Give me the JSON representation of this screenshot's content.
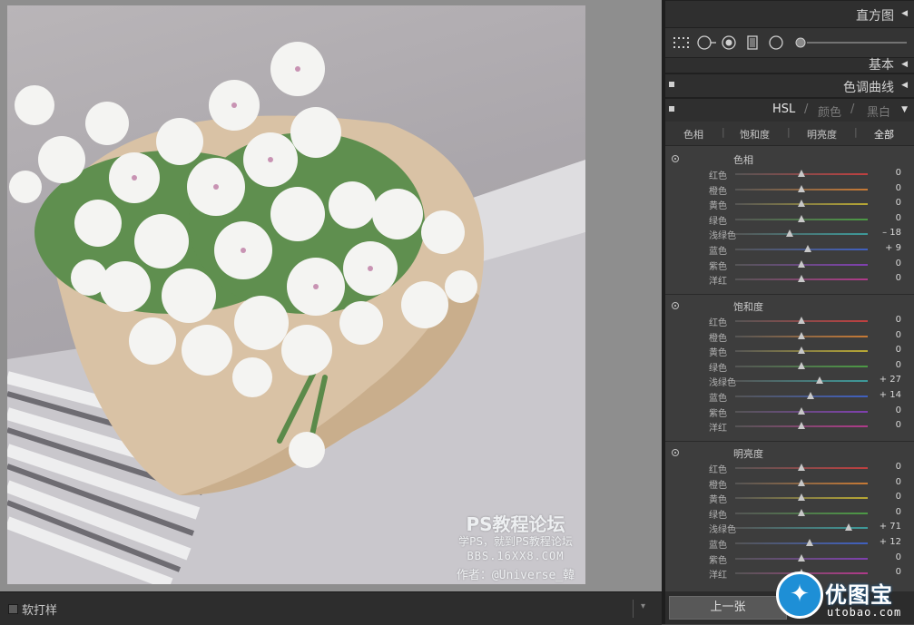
{
  "watermark": {
    "title": "PS教程论坛",
    "subtitle": "学PS，就到PS教程论坛",
    "url": "BBS.16XX8.COM",
    "author": "作者：@Universe_韓"
  },
  "toolbar": {
    "softproof_label": "软打样",
    "menu_icon": "▾"
  },
  "panels": {
    "histogram": {
      "title": "直方图",
      "arrow": "◀"
    },
    "basic": {
      "title": "基本",
      "arrow": "◀"
    },
    "tone_curve": {
      "title": "色调曲线",
      "arrow": "◀"
    },
    "hsl": {
      "tabs_header": [
        "HSL",
        "/",
        "颜色",
        "/",
        "黑白"
      ],
      "arrow": "▼"
    }
  },
  "hsl_tabs": [
    "色相",
    "饱和度",
    "明亮度",
    "全部"
  ],
  "sections": [
    {
      "title": "色相",
      "rows": [
        {
          "label": "红色",
          "value": "0",
          "level": 0,
          "color": "#c04040"
        },
        {
          "label": "橙色",
          "value": "0",
          "level": 0,
          "color": "#c77a35"
        },
        {
          "label": "黄色",
          "value": "0",
          "level": 0,
          "color": "#b8a834"
        },
        {
          "label": "绿色",
          "value": "0",
          "level": 0,
          "color": "#4c9a45"
        },
        {
          "label": "浅绿色",
          "value": "– 18",
          "level": -18,
          "color": "#3d9a9a"
        },
        {
          "label": "蓝色",
          "value": "+ 9",
          "level": 9,
          "color": "#4060c0"
        },
        {
          "label": "紫色",
          "value": "0",
          "level": 0,
          "color": "#8040b0"
        },
        {
          "label": "洋红",
          "value": "0",
          "level": 0,
          "color": "#b03a8a"
        }
      ]
    },
    {
      "title": "饱和度",
      "rows": [
        {
          "label": "红色",
          "value": "0",
          "level": 0,
          "color": "#c04040"
        },
        {
          "label": "橙色",
          "value": "0",
          "level": 0,
          "color": "#c77a35"
        },
        {
          "label": "黄色",
          "value": "0",
          "level": 0,
          "color": "#b8a834"
        },
        {
          "label": "绿色",
          "value": "0",
          "level": 0,
          "color": "#4c9a45"
        },
        {
          "label": "浅绿色",
          "value": "+ 27",
          "level": 27,
          "color": "#3d9a9a"
        },
        {
          "label": "蓝色",
          "value": "+ 14",
          "level": 14,
          "color": "#4060c0"
        },
        {
          "label": "紫色",
          "value": "0",
          "level": 0,
          "color": "#8040b0"
        },
        {
          "label": "洋红",
          "value": "0",
          "level": 0,
          "color": "#b03a8a"
        }
      ]
    },
    {
      "title": "明亮度",
      "rows": [
        {
          "label": "红色",
          "value": "0",
          "level": 0,
          "color": "#c04040"
        },
        {
          "label": "橙色",
          "value": "0",
          "level": 0,
          "color": "#c77a35"
        },
        {
          "label": "黄色",
          "value": "0",
          "level": 0,
          "color": "#b8a834"
        },
        {
          "label": "绿色",
          "value": "0",
          "level": 0,
          "color": "#4c9a45"
        },
        {
          "label": "浅绿色",
          "value": "+ 71",
          "level": 71,
          "color": "#3d9a9a"
        },
        {
          "label": "蓝色",
          "value": "+ 12",
          "level": 12,
          "color": "#4060c0"
        },
        {
          "label": "紫色",
          "value": "0",
          "level": 0,
          "color": "#8040b0"
        },
        {
          "label": "洋红",
          "value": "0",
          "level": 0,
          "color": "#b03a8a"
        }
      ]
    }
  ],
  "nav": {
    "prev_label": "上一张"
  },
  "logo": {
    "name": "优图宝",
    "url": "utobao.com"
  }
}
